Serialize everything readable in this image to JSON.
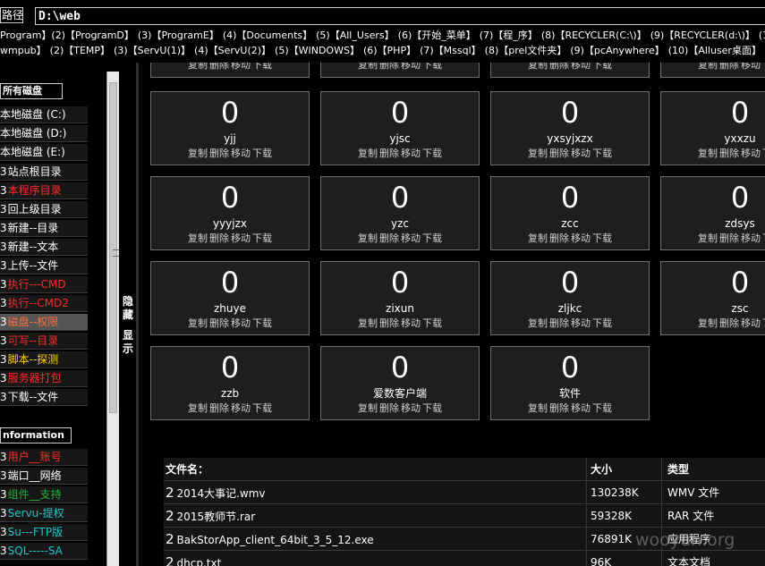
{
  "path": {
    "label": "路径",
    "value": "D:\\web"
  },
  "dirs_row1": [
    "Program】(2)【ProgramD】",
    "(3)【ProgramE】",
    "(4)【Documents】",
    "(5)【All_Users】",
    "(6)【开始_菜单】",
    "(7)【程_序】",
    "(8)【RECYCLER(C:\\)】",
    "(9)【RECYCLER(d:\\)】",
    "(10)【RECYCLE"
  ],
  "dirs_row2": [
    "wmpub】",
    "(2)【TEMP】",
    "(3)【ServU(1)】",
    "(4)【ServU(2)】",
    "(5)【WINDOWS】",
    "(6)【PHP】",
    "(7)【Mssql】",
    "(8)【prel文件夹】",
    "(9)【pcAnywhere】",
    "(10)【Alluser桌面】"
  ],
  "sidebar": {
    "disks_head": "所有磁盘",
    "disks": [
      "本地磁盘 (C:)",
      "本地磁盘 (D:)",
      "本地磁盘 (E:)"
    ],
    "tools": [
      {
        "pre": "3",
        "label": "站点根目录",
        "color": "white"
      },
      {
        "pre": "3",
        "label": "本程序目录",
        "color": "red"
      },
      {
        "pre": "3",
        "label": "回上级目录",
        "color": "white"
      },
      {
        "pre": "3",
        "label": "新建--目录",
        "color": "white"
      },
      {
        "pre": "3",
        "label": "新建--文本",
        "color": "white"
      },
      {
        "pre": "3",
        "label": "上传--文件",
        "color": "white"
      },
      {
        "pre": "3",
        "label": "执行---CMD",
        "color": "red"
      },
      {
        "pre": "3",
        "label": "执行--CMD2",
        "color": "red"
      },
      {
        "pre": "3",
        "label": "磁盘--权限",
        "color": "hl"
      },
      {
        "pre": "3",
        "label": "可写--目录",
        "color": "red"
      },
      {
        "pre": "3",
        "label": "脚本--探测",
        "color": "yellow"
      },
      {
        "pre": "3",
        "label": "服务器打包",
        "color": "red"
      },
      {
        "pre": "3",
        "label": "下载--文件",
        "color": "white"
      }
    ],
    "info_head": "nformation",
    "info": [
      {
        "pre": "3",
        "label": "用户__账号",
        "color": "red"
      },
      {
        "pre": "3",
        "label": "端口__网络",
        "color": "white"
      },
      {
        "pre": "3",
        "label": "组件__支持",
        "color": "green"
      },
      {
        "pre": "3",
        "label": "Servu-提权",
        "color": "cyan"
      },
      {
        "pre": "3",
        "label": "Su---FTP版",
        "color": "cyan"
      },
      {
        "pre": "3",
        "label": "SQL-----SA",
        "color": "cyan"
      }
    ]
  },
  "toggle": {
    "hide": [
      "隐",
      "藏"
    ],
    "show": [
      "显",
      "示"
    ]
  },
  "card_actions": [
    "复制",
    "删除",
    "移动",
    "下载"
  ],
  "folders_partial_row": [
    "",
    "",
    "",
    ""
  ],
  "folders": [
    {
      "count": "0",
      "name": "yjj"
    },
    {
      "count": "0",
      "name": "yjsc"
    },
    {
      "count": "0",
      "name": "yxsyjxzx"
    },
    {
      "count": "0",
      "name": "yxxzu"
    },
    {
      "count": "0",
      "name": "yyyjzx"
    },
    {
      "count": "0",
      "name": "yzc"
    },
    {
      "count": "0",
      "name": "zcc"
    },
    {
      "count": "0",
      "name": "zdsys"
    },
    {
      "count": "0",
      "name": "zhuye"
    },
    {
      "count": "0",
      "name": "zixun"
    },
    {
      "count": "0",
      "name": "zljkc"
    },
    {
      "count": "0",
      "name": "zsc"
    },
    {
      "count": "0",
      "name": "zzb"
    },
    {
      "count": "0",
      "name": "爱数客户端"
    },
    {
      "count": "0",
      "name": "软件"
    }
  ],
  "files": {
    "headers": [
      "文件名：",
      "大小",
      "类型"
    ],
    "rows": [
      {
        "idx": "2",
        "name": "2014大事记.wmv",
        "size": "130238K",
        "type": "WMV 文件"
      },
      {
        "idx": "2",
        "name": "2015教师节.rar",
        "size": "59328K",
        "type": "RAR 文件"
      },
      {
        "idx": "2",
        "name": "BakStorApp_client_64bit_3_5_12.exe",
        "size": "76891K",
        "type": "应用程序"
      },
      {
        "idx": "2",
        "name": "dhcp.txt",
        "size": "96K",
        "type": "文本文档"
      }
    ]
  },
  "watermark": "wooyun.org"
}
